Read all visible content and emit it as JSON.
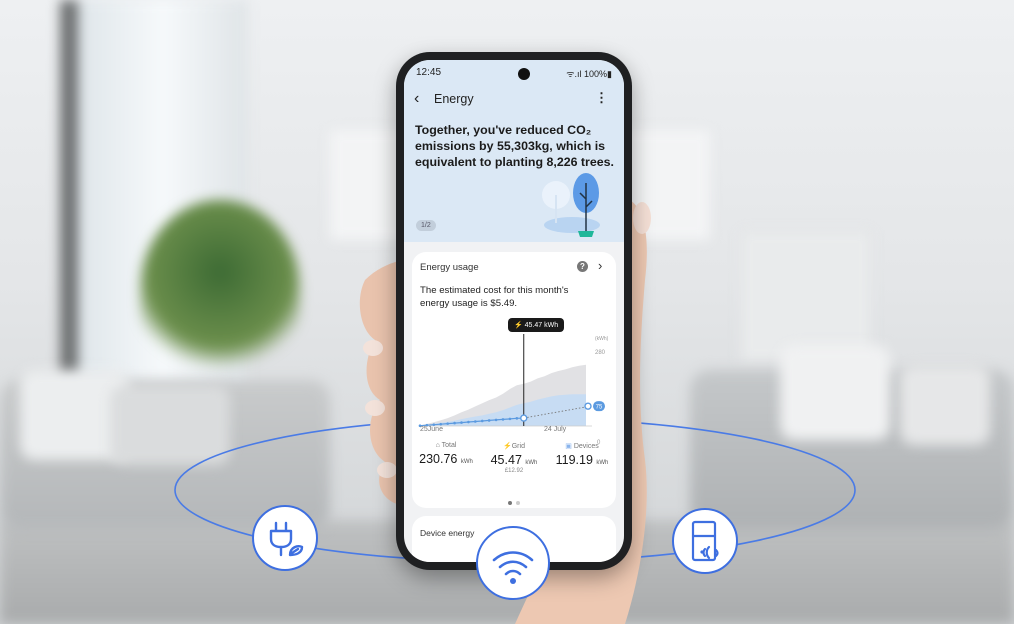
{
  "status_bar": {
    "time": "12:45",
    "right": "ᯤ.ıl 100%▮"
  },
  "app_bar": {
    "back_icon": "chevron-left-icon",
    "title": "Energy",
    "more_icon": "more-vert-icon"
  },
  "banner": {
    "headline": "Together, you've reduced CO₂ emissions by 55,303kg, which is equivalent to planting 8,226 trees.",
    "pager": "1/2"
  },
  "energy_card": {
    "title": "Energy usage",
    "summary": "The estimated cost for this month's energy usage is $5.49.",
    "tooltip": "⚡ 45.47 kWh",
    "unit_label": "(kWh)",
    "marker_value": "75",
    "stats": [
      {
        "label": "Total",
        "value": "230.76",
        "unit": "kWh",
        "sub": ""
      },
      {
        "label": "Grid",
        "value": "45.47",
        "unit": "kWh",
        "sub": "£12.92"
      },
      {
        "label": "Devices",
        "value": "119.19",
        "unit": "kWh",
        "sub": ""
      }
    ],
    "page_dots": {
      "count": 2,
      "active": 0
    }
  },
  "chart_data": {
    "type": "area",
    "title": "",
    "x": [
      "25June",
      "",
      "",
      "",
      "",
      "",
      "",
      "",
      "",
      "",
      "",
      "",
      "",
      "",
      "",
      "",
      "",
      "",
      "",
      "",
      "",
      "",
      "",
      "",
      "24 July"
    ],
    "xticks": [
      "25June",
      "24 July"
    ],
    "yticks": [
      "0",
      "75",
      "280"
    ],
    "ylim": [
      0,
      280
    ],
    "series": [
      {
        "values": [
          2,
          8,
          14,
          22,
          30,
          40,
          52,
          62,
          74,
          86,
          98,
          108,
          122,
          140,
          154,
          160,
          168,
          180,
          188,
          200,
          208,
          214,
          222,
          228,
          232
        ]
      },
      {
        "values": [
          1,
          4,
          8,
          12,
          16,
          20,
          26,
          31,
          36,
          40,
          46,
          52,
          60,
          70,
          80,
          86,
          92,
          100,
          106,
          112,
          116,
          118,
          120,
          120,
          120
        ]
      },
      {
        "values": [
          1,
          3,
          5,
          7,
          9,
          11,
          13,
          15,
          17,
          19,
          21,
          23,
          25,
          27,
          29,
          30,
          32,
          34,
          36,
          38,
          40,
          42,
          44,
          45,
          46
        ]
      }
    ],
    "grid": false,
    "colors": {
      "total": "#e1e1e4",
      "devices": "#c7dcf3",
      "grid": "#5b9ae0"
    }
  },
  "device_card": {
    "title": "Device energy"
  },
  "features": [
    {
      "icon": "plug-leaf-icon"
    },
    {
      "icon": "wifi-icon"
    },
    {
      "icon": "smart-fridge-icon"
    }
  ],
  "colors": {
    "accent": "#3e6fe0",
    "banner_bg": "#dbe8f5"
  }
}
